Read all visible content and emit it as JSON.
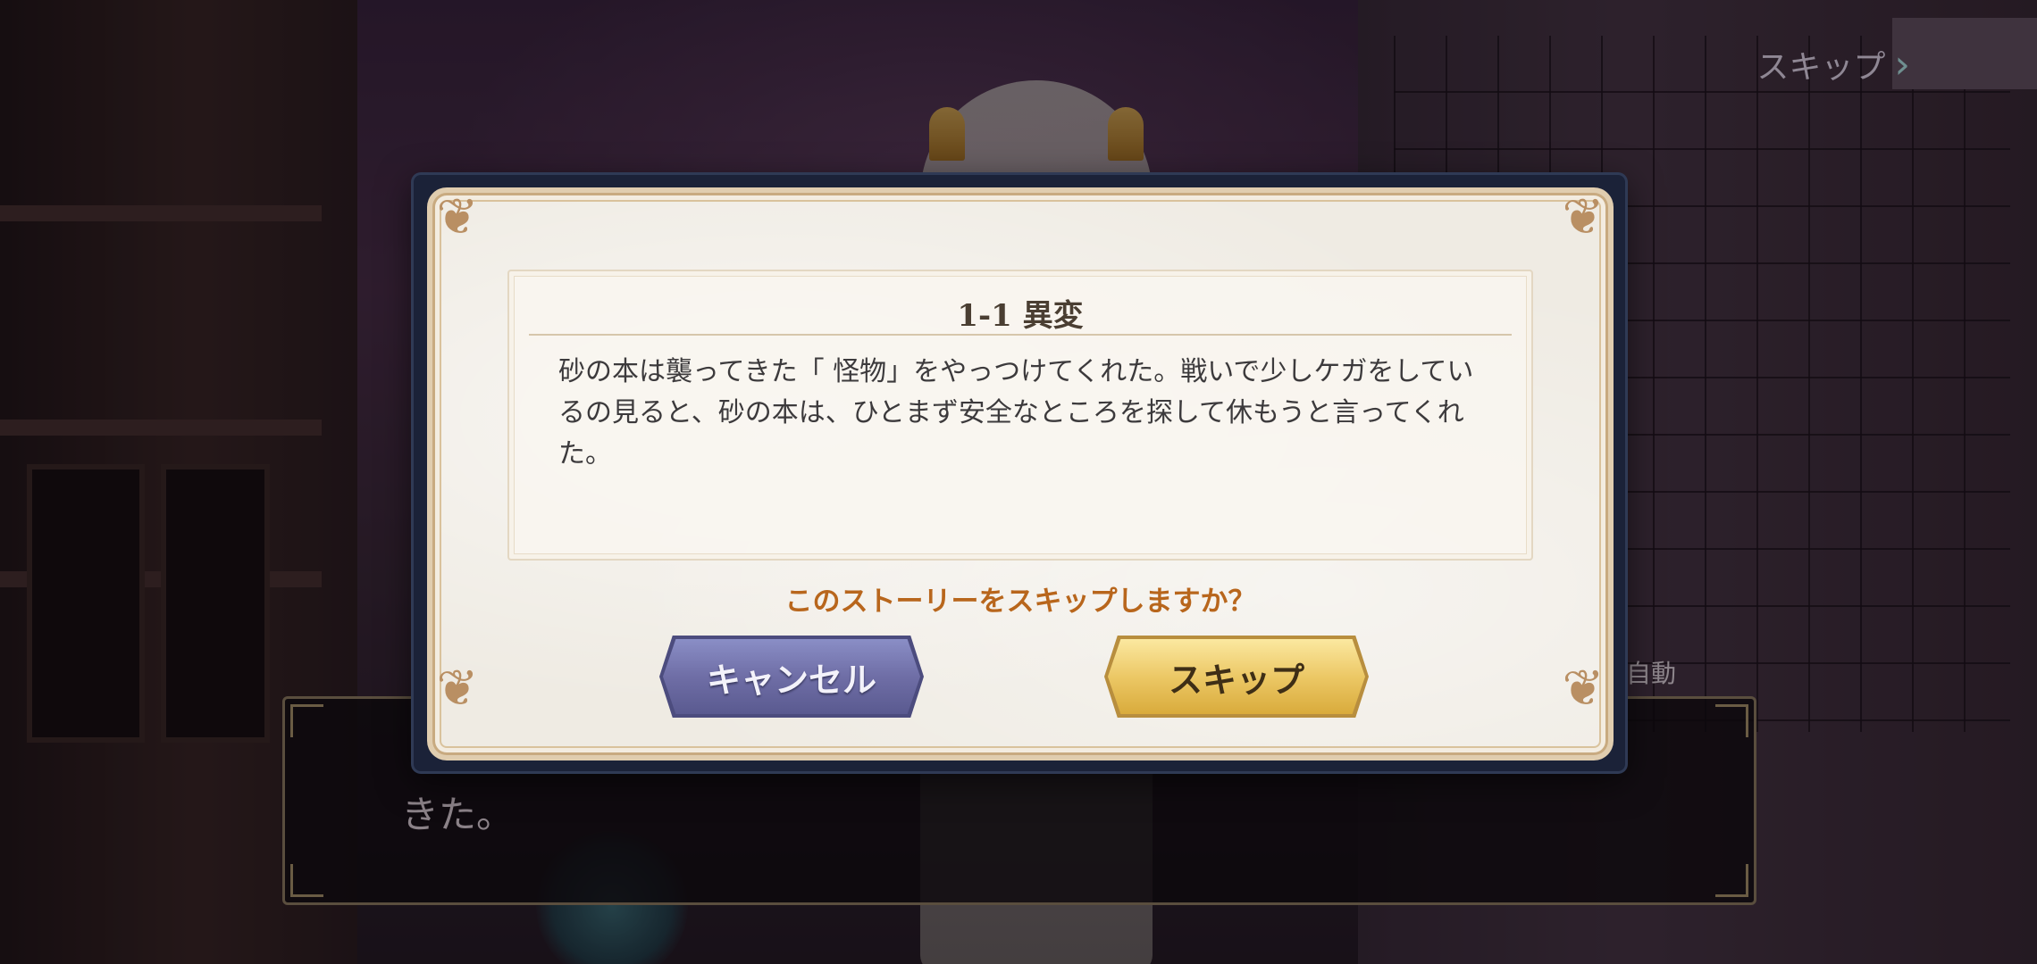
{
  "top_bar": {
    "skip_label": "スキップ"
  },
  "dialogue": {
    "text": "きた。",
    "auto_label": "自動"
  },
  "modal": {
    "title": "1-1 異変",
    "body": "砂の本は襲ってきた「 怪物」をやっつけてくれた。戦いで少しケガをしているの見ると、砂の本は、ひとまず安全なところを探して休もうと言ってくれた。",
    "question": "このストーリーをスキップしますか？",
    "cancel_label": "キャンセル",
    "skip_label": "スキップ"
  },
  "colors": {
    "question": "#b8661c",
    "cancel_button": "#6f6ea6",
    "skip_button": "#ecc866"
  }
}
